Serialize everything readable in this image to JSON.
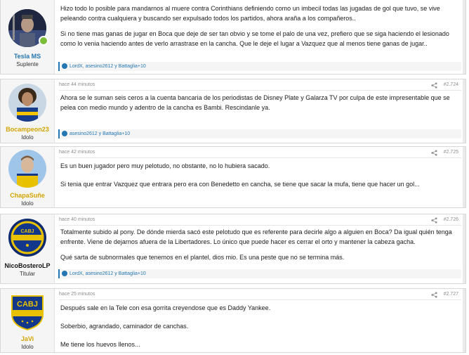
{
  "posts": [
    {
      "username": "Tesla MS",
      "username_color": "#2577b1",
      "usertitle": "Suplente",
      "time": "",
      "number": "",
      "paragraphs": [
        "Hizo todo lo posible para mandarnos al muere contra Corinthians definiendo como un imbecil todas las jugadas de gol que tuvo, se vive peleando contra cualquiera y buscando ser expulsado todos los partidos, ahora araña a los compañeros..",
        "Si no tiene mas ganas de jugar en Boca que deje de ser tan obvio y se tome el palo de una vez, prefiero que se siga haciendo el lesionado como lo venia haciendo antes de verlo arrastrase en la cancha. Que le deje el lugar a Vazquez que al menos tiene ganas de jugar.."
      ],
      "reactions": "LordX, asesino2612 y Battaglia+10",
      "online": true
    },
    {
      "username": "Bocampeon23",
      "username_color": "#d4a400",
      "usertitle": "Idolo",
      "time": "hace 44 minutos",
      "number": "#2.724",
      "paragraphs": [
        "Ahora se le suman seis ceros a la cuenta bancaria de los periodistas de Disney Plate y Galarza TV por culpa de este impresentable que se pelea con medio mundo y adentro de la cancha es Bambi. Rescindanle ya."
      ],
      "reactions": "asesino2612 y Battaglia+10",
      "online": false
    },
    {
      "username": "ChapaSuñe",
      "username_color": "#d4a400",
      "usertitle": "Idolo",
      "time": "hace 42 minutos",
      "number": "#2.725",
      "paragraphs": [
        "Es un buen jugador pero muy pelotudo, no obstante, no lo hubiera sacado.",
        "Si tenia que entrar Vazquez que entrara pero era con Benedetto en cancha, se tiene que sacar la mufa, tiene que hacer un gol..."
      ],
      "reactions": "",
      "online": false
    },
    {
      "username": "NicoBosteroLP",
      "username_color": "#141414",
      "usertitle": "Titular",
      "time": "hace 40 minutos",
      "number": "#2.726",
      "paragraphs": [
        "Totalmente subido al pony. De dónde mierda sacó este pelotudo que es referente para decirle algo a alguien en Boca? Da igual quién tenga enfrente. Viene de dejarnos afuera de la Libertadores. Lo único que puede hacer es cerrar el orto y mantener la cabeza gacha.",
        "Qué sarta de subnormales que tenemos en el plantel, dios mio. Es una peste que no se termina más."
      ],
      "reactions": "LordX, asesino2612 y Battaglia+10",
      "online": false
    },
    {
      "username": "JaVi",
      "username_color": "#d4a400",
      "usertitle": "Idolo",
      "time": "hace 25 minutos",
      "number": "#2.727",
      "paragraphs": [
        "Después sale en la Tele con esa gorrita creyendose que es Daddy Yankee.",
        "Soberbio, agrandado, caminador de canchas.",
        "Me tiene los huevos llenos..."
      ],
      "reactions": "",
      "online": false
    }
  ]
}
